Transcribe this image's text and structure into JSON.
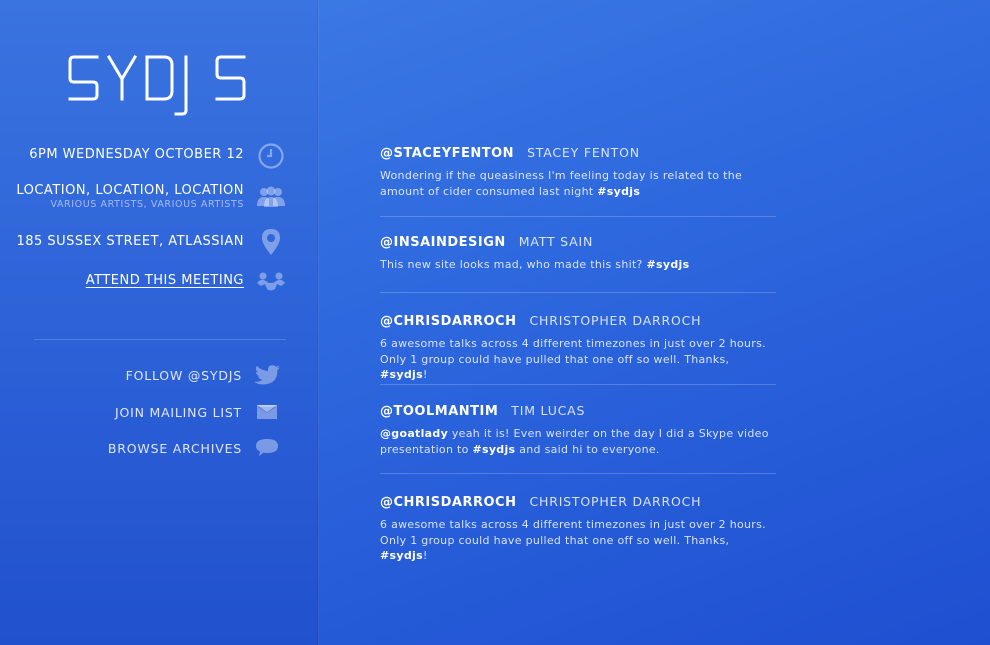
{
  "brand": {
    "logo_text": "SYDJS"
  },
  "event": {
    "time": "6PM WEDNESDAY OCTOBER 12",
    "speakers": "LOCATION, LOCATION, LOCATION",
    "speakers_sub": "VARIOUS ARTISTS, VARIOUS ARTISTS",
    "address": "185 SUSSEX STREET, ATLASSIAN",
    "attend_label": "ATTEND THIS MEETING"
  },
  "links": {
    "follow": "FOLLOW @SYDJS",
    "mailing": "JOIN MAILING LIST",
    "archives": "BROWSE ARCHIVES"
  },
  "tweets": [
    {
      "handle": "@STACEYFENTON",
      "name": "STACEY FENTON",
      "text": "Wondering if the queasiness I'm feeling today is related to the amount of cider consumed last night ",
      "tag": "#sydjs",
      "after": ""
    },
    {
      "handle": "@INSAINDESIGN",
      "name": "MATT SAIN",
      "text": "This new site looks mad, who made this shit? ",
      "tag": "#sydjs",
      "after": ""
    },
    {
      "handle": "@CHRISDARROCH",
      "name": "CHRISTOPHER DARROCH",
      "text": "6 awesome talks across 4 different timezones in just over 2 hours. Only 1 group could have pulled that one off so well. Thanks, ",
      "tag": "#sydjs",
      "after": "!"
    },
    {
      "handle": "@TOOLMANTIM",
      "name": "TIM LUCAS",
      "mention": "@goatlady",
      "text": " yeah it is! Even weirder on the day I did a Skype video presentation to ",
      "tag": "#sydjs",
      "after": " and said hi to everyone."
    },
    {
      "handle": "@CHRISDARROCH",
      "name": "CHRISTOPHER DARROCH",
      "text": "6 awesome talks across 4 different timezones in just over 2 hours. Only 1 group could have pulled that one off so well. Thanks, ",
      "tag": "#sydjs",
      "after": "!"
    }
  ],
  "icons": [
    "clock-icon",
    "people-icon",
    "map-pin-icon",
    "handshake-icon",
    "twitter-bird-icon",
    "envelope-icon",
    "speech-bubble-icon"
  ]
}
